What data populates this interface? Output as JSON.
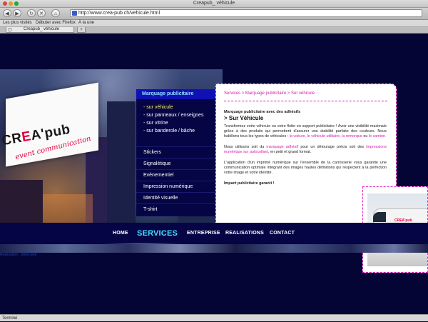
{
  "browser": {
    "window_title": "Creapub_ véhicule",
    "url": "http://www.crea-pub.ch/vehicule.html",
    "bookmarks": [
      "Les plus visités",
      "Débuter avec Firefox",
      "À la une"
    ],
    "tab_title": "Creapub_ véhicule",
    "new_tab": "+",
    "status": "Terminé",
    "colors": {
      "close": "#e0443e",
      "minimize": "#dea123",
      "zoom": "#1aab29"
    }
  },
  "logo": {
    "brand_left": "CR",
    "brand_mid": "E",
    "brand_right": "A'pub",
    "tagline": "event communication"
  },
  "sidebar": {
    "heading": "Marquage publicitaire",
    "submenu": [
      "- sur véhicule",
      "- sur panneaux / enseignes",
      "- sur vitrine",
      "- sur banderole / bâche"
    ],
    "items": [
      "Stickers",
      "Signalétique",
      "Evénementiel",
      "Impression numérique",
      "Identité visuelle",
      "T-shirt"
    ]
  },
  "content": {
    "breadcrumb": "Services > Marquage publicitaire > Sur véhicule",
    "title": "Marquage publicitaire avec des adhésifs",
    "subtitle": "> Sur Véhicule",
    "p1": "Transformez votre véhicule ou votre flotte en support publicitaire ! Avoir une visibilité maximale grâce à des produits qui permettent d'assurer une stabilité parfaite des couleurs. Nous habillons tous les types de véhicules :",
    "p1_links": "la voiture, le véhicule utilitaire, la remorque",
    "p1_and": "ou",
    "p1_link2": "le camion.",
    "p2_a": "Nous utilisons soit du",
    "p2_link1": "marquage adhésif",
    "p2_b": "pour un détourage précis soit des",
    "p2_link2": "impressions numérique sur autocollant",
    "p2_c": ", en petit et grand format.",
    "p3": "L'application d'un imprimé numérique sur l'ensemble de la carrosserie vous garantie une communication optimale intégrant des images hautes définitions qui respectent à la perfection votre image et votre identité.",
    "closing": "Impact publicitaire garanti !"
  },
  "nav": {
    "home": "HOME",
    "services": "SERVICES",
    "entreprise": "ENTREPRISE",
    "realisations": "REALISATIONS",
    "contact": "CONTACT"
  },
  "van": {
    "logo": "CREA'pub"
  },
  "footer_link": "Réalisation : cléria web"
}
